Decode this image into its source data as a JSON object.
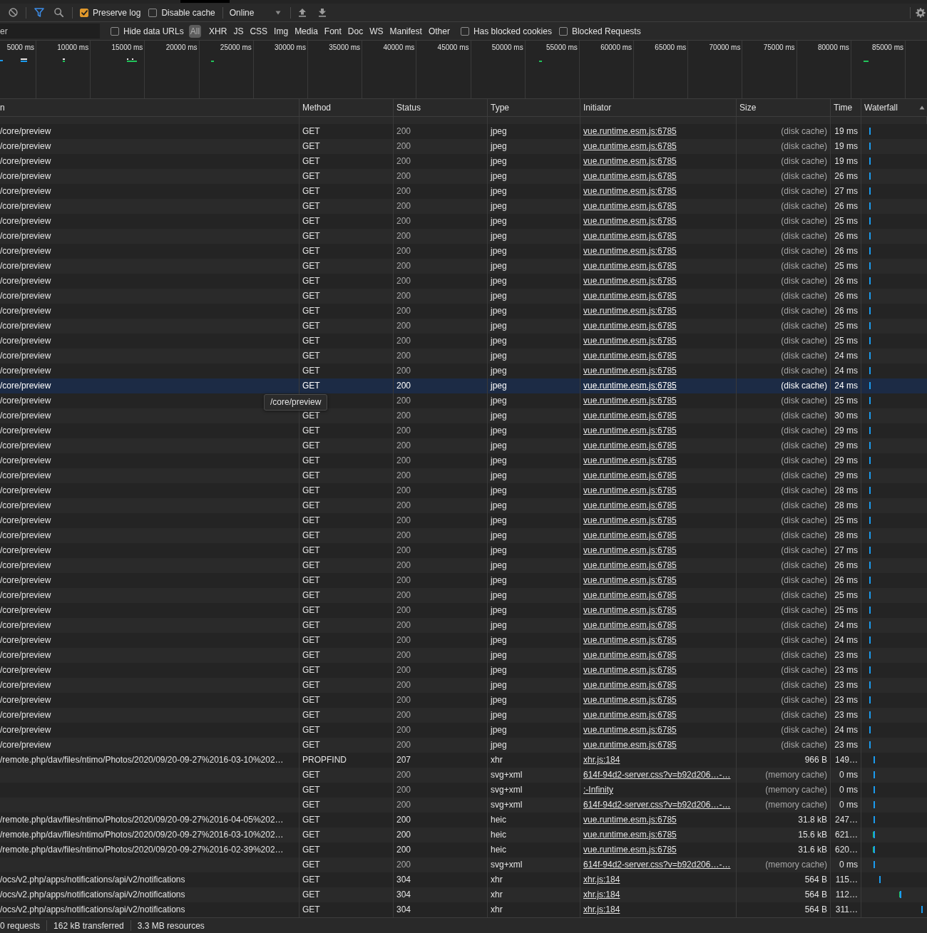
{
  "toolbar": {
    "filter_toggle": {
      "on": true
    },
    "options": [
      {
        "label": "Preserve log",
        "checked": true
      },
      {
        "label": "Disable cache",
        "checked": false
      }
    ],
    "throttling": {
      "value": "Online"
    }
  },
  "filter_bar": {
    "filter_field": {
      "placeholder": "er"
    },
    "hide_data_urls": {
      "label": "Hide data URLs",
      "checked": false
    },
    "types": [
      {
        "label": "All",
        "selected": true
      },
      {
        "label": "XHR",
        "selected": false
      },
      {
        "label": "JS",
        "selected": false
      },
      {
        "label": "CSS",
        "selected": false
      },
      {
        "label": "Img",
        "selected": false
      },
      {
        "label": "Media",
        "selected": false
      },
      {
        "label": "Font",
        "selected": false
      },
      {
        "label": "Doc",
        "selected": false
      },
      {
        "label": "WS",
        "selected": false
      },
      {
        "label": "Manifest",
        "selected": false
      },
      {
        "label": "Other",
        "selected": false
      }
    ],
    "options": [
      {
        "label": "Has blocked cookies",
        "checked": false
      },
      {
        "label": "Blocked Requests",
        "checked": false
      }
    ]
  },
  "overview": {
    "ticks": [
      "5000 ms",
      "10000 ms",
      "15000 ms",
      "20000 ms",
      "25000 ms",
      "30000 ms",
      "35000 ms",
      "40000 ms",
      "45000 ms",
      "50000 ms",
      "55000 ms",
      "60000 ms",
      "65000 ms",
      "70000 ms",
      "75000 ms",
      "80000 ms",
      "85000 ms"
    ]
  },
  "table": {
    "columns": [
      {
        "label": "n",
        "sorted": false
      },
      {
        "label": "Method",
        "sorted": false
      },
      {
        "label": "Status",
        "sorted": false
      },
      {
        "label": "Type",
        "sorted": false
      },
      {
        "label": "Initiator",
        "sorted": false
      },
      {
        "label": "Size",
        "sorted": false
      },
      {
        "label": "Time",
        "sorted": false
      },
      {
        "label": "Waterfall",
        "sorted": true
      }
    ],
    "rows": [
      {
        "name": "/core/preview",
        "method": "GET",
        "status": "200",
        "type": "jpeg",
        "initiator": "vue.runtime.esm.js:6785",
        "size": "(disk cache)",
        "time": "19 ms",
        "cached": true,
        "selected": false
      },
      {
        "name": "/core/preview",
        "method": "GET",
        "status": "200",
        "type": "jpeg",
        "initiator": "vue.runtime.esm.js:6785",
        "size": "(disk cache)",
        "time": "19 ms",
        "cached": true,
        "selected": false
      },
      {
        "name": "/core/preview",
        "method": "GET",
        "status": "200",
        "type": "jpeg",
        "initiator": "vue.runtime.esm.js:6785",
        "size": "(disk cache)",
        "time": "19 ms",
        "cached": true,
        "selected": false
      },
      {
        "name": "/core/preview",
        "method": "GET",
        "status": "200",
        "type": "jpeg",
        "initiator": "vue.runtime.esm.js:6785",
        "size": "(disk cache)",
        "time": "26 ms",
        "cached": true,
        "selected": false
      },
      {
        "name": "/core/preview",
        "method": "GET",
        "status": "200",
        "type": "jpeg",
        "initiator": "vue.runtime.esm.js:6785",
        "size": "(disk cache)",
        "time": "27 ms",
        "cached": true,
        "selected": false
      },
      {
        "name": "/core/preview",
        "method": "GET",
        "status": "200",
        "type": "jpeg",
        "initiator": "vue.runtime.esm.js:6785",
        "size": "(disk cache)",
        "time": "26 ms",
        "cached": true,
        "selected": false
      },
      {
        "name": "/core/preview",
        "method": "GET",
        "status": "200",
        "type": "jpeg",
        "initiator": "vue.runtime.esm.js:6785",
        "size": "(disk cache)",
        "time": "25 ms",
        "cached": true,
        "selected": false
      },
      {
        "name": "/core/preview",
        "method": "GET",
        "status": "200",
        "type": "jpeg",
        "initiator": "vue.runtime.esm.js:6785",
        "size": "(disk cache)",
        "time": "26 ms",
        "cached": true,
        "selected": false
      },
      {
        "name": "/core/preview",
        "method": "GET",
        "status": "200",
        "type": "jpeg",
        "initiator": "vue.runtime.esm.js:6785",
        "size": "(disk cache)",
        "time": "26 ms",
        "cached": true,
        "selected": false
      },
      {
        "name": "/core/preview",
        "method": "GET",
        "status": "200",
        "type": "jpeg",
        "initiator": "vue.runtime.esm.js:6785",
        "size": "(disk cache)",
        "time": "25 ms",
        "cached": true,
        "selected": false
      },
      {
        "name": "/core/preview",
        "method": "GET",
        "status": "200",
        "type": "jpeg",
        "initiator": "vue.runtime.esm.js:6785",
        "size": "(disk cache)",
        "time": "26 ms",
        "cached": true,
        "selected": false
      },
      {
        "name": "/core/preview",
        "method": "GET",
        "status": "200",
        "type": "jpeg",
        "initiator": "vue.runtime.esm.js:6785",
        "size": "(disk cache)",
        "time": "26 ms",
        "cached": true,
        "selected": false
      },
      {
        "name": "/core/preview",
        "method": "GET",
        "status": "200",
        "type": "jpeg",
        "initiator": "vue.runtime.esm.js:6785",
        "size": "(disk cache)",
        "time": "26 ms",
        "cached": true,
        "selected": false
      },
      {
        "name": "/core/preview",
        "method": "GET",
        "status": "200",
        "type": "jpeg",
        "initiator": "vue.runtime.esm.js:6785",
        "size": "(disk cache)",
        "time": "25 ms",
        "cached": true,
        "selected": false
      },
      {
        "name": "/core/preview",
        "method": "GET",
        "status": "200",
        "type": "jpeg",
        "initiator": "vue.runtime.esm.js:6785",
        "size": "(disk cache)",
        "time": "25 ms",
        "cached": true,
        "selected": false
      },
      {
        "name": "/core/preview",
        "method": "GET",
        "status": "200",
        "type": "jpeg",
        "initiator": "vue.runtime.esm.js:6785",
        "size": "(disk cache)",
        "time": "24 ms",
        "cached": true,
        "selected": false
      },
      {
        "name": "/core/preview",
        "method": "GET",
        "status": "200",
        "type": "jpeg",
        "initiator": "vue.runtime.esm.js:6785",
        "size": "(disk cache)",
        "time": "24 ms",
        "cached": true,
        "selected": false
      },
      {
        "name": "/core/preview",
        "method": "GET",
        "status": "200",
        "type": "jpeg",
        "initiator": "vue.runtime.esm.js:6785",
        "size": "(disk cache)",
        "time": "24 ms",
        "cached": true,
        "selected": true
      },
      {
        "name": "/core/preview",
        "status": "200",
        "type": "jpeg",
        "initiator": "vue.runtime.esm.js:6785",
        "size": "(disk cache)",
        "time": "25 ms",
        "cached": true,
        "selected": false
      },
      {
        "name": "/core/preview",
        "method": "GET",
        "status": "200",
        "type": "jpeg",
        "initiator": "vue.runtime.esm.js:6785",
        "size": "(disk cache)",
        "time": "30 ms",
        "cached": true,
        "selected": false
      },
      {
        "name": "/core/preview",
        "method": "GET",
        "status": "200",
        "type": "jpeg",
        "initiator": "vue.runtime.esm.js:6785",
        "size": "(disk cache)",
        "time": "29 ms",
        "cached": true,
        "selected": false
      },
      {
        "name": "/core/preview",
        "method": "GET",
        "status": "200",
        "type": "jpeg",
        "initiator": "vue.runtime.esm.js:6785",
        "size": "(disk cache)",
        "time": "29 ms",
        "cached": true,
        "selected": false
      },
      {
        "name": "/core/preview",
        "method": "GET",
        "status": "200",
        "type": "jpeg",
        "initiator": "vue.runtime.esm.js:6785",
        "size": "(disk cache)",
        "time": "29 ms",
        "cached": true,
        "selected": false
      },
      {
        "name": "/core/preview",
        "method": "GET",
        "status": "200",
        "type": "jpeg",
        "initiator": "vue.runtime.esm.js:6785",
        "size": "(disk cache)",
        "time": "29 ms",
        "cached": true,
        "selected": false
      },
      {
        "name": "/core/preview",
        "method": "GET",
        "status": "200",
        "type": "jpeg",
        "initiator": "vue.runtime.esm.js:6785",
        "size": "(disk cache)",
        "time": "28 ms",
        "cached": true,
        "selected": false
      },
      {
        "name": "/core/preview",
        "method": "GET",
        "status": "200",
        "type": "jpeg",
        "initiator": "vue.runtime.esm.js:6785",
        "size": "(disk cache)",
        "time": "28 ms",
        "cached": true,
        "selected": false
      },
      {
        "name": "/core/preview",
        "method": "GET",
        "status": "200",
        "type": "jpeg",
        "initiator": "vue.runtime.esm.js:6785",
        "size": "(disk cache)",
        "time": "25 ms",
        "cached": true,
        "selected": false
      },
      {
        "name": "/core/preview",
        "method": "GET",
        "status": "200",
        "type": "jpeg",
        "initiator": "vue.runtime.esm.js:6785",
        "size": "(disk cache)",
        "time": "28 ms",
        "cached": true,
        "selected": false
      },
      {
        "name": "/core/preview",
        "method": "GET",
        "status": "200",
        "type": "jpeg",
        "initiator": "vue.runtime.esm.js:6785",
        "size": "(disk cache)",
        "time": "27 ms",
        "cached": true,
        "selected": false
      },
      {
        "name": "/core/preview",
        "method": "GET",
        "status": "200",
        "type": "jpeg",
        "initiator": "vue.runtime.esm.js:6785",
        "size": "(disk cache)",
        "time": "26 ms",
        "cached": true,
        "selected": false
      },
      {
        "name": "/core/preview",
        "method": "GET",
        "status": "200",
        "type": "jpeg",
        "initiator": "vue.runtime.esm.js:6785",
        "size": "(disk cache)",
        "time": "26 ms",
        "cached": true,
        "selected": false
      },
      {
        "name": "/core/preview",
        "method": "GET",
        "status": "200",
        "type": "jpeg",
        "initiator": "vue.runtime.esm.js:6785",
        "size": "(disk cache)",
        "time": "25 ms",
        "cached": true,
        "selected": false
      },
      {
        "name": "/core/preview",
        "method": "GET",
        "status": "200",
        "type": "jpeg",
        "initiator": "vue.runtime.esm.js:6785",
        "size": "(disk cache)",
        "time": "25 ms",
        "cached": true,
        "selected": false
      },
      {
        "name": "/core/preview",
        "method": "GET",
        "status": "200",
        "type": "jpeg",
        "initiator": "vue.runtime.esm.js:6785",
        "size": "(disk cache)",
        "time": "24 ms",
        "cached": true,
        "selected": false
      },
      {
        "name": "/core/preview",
        "method": "GET",
        "status": "200",
        "type": "jpeg",
        "initiator": "vue.runtime.esm.js:6785",
        "size": "(disk cache)",
        "time": "24 ms",
        "cached": true,
        "selected": false
      },
      {
        "name": "/core/preview",
        "method": "GET",
        "status": "200",
        "type": "jpeg",
        "initiator": "vue.runtime.esm.js:6785",
        "size": "(disk cache)",
        "time": "23 ms",
        "cached": true,
        "selected": false
      },
      {
        "name": "/core/preview",
        "method": "GET",
        "status": "200",
        "type": "jpeg",
        "initiator": "vue.runtime.esm.js:6785",
        "size": "(disk cache)",
        "time": "23 ms",
        "cached": true,
        "selected": false
      },
      {
        "name": "/core/preview",
        "method": "GET",
        "status": "200",
        "type": "jpeg",
        "initiator": "vue.runtime.esm.js:6785",
        "size": "(disk cache)",
        "time": "23 ms",
        "cached": true,
        "selected": false
      },
      {
        "name": "/core/preview",
        "method": "GET",
        "status": "200",
        "type": "jpeg",
        "initiator": "vue.runtime.esm.js:6785",
        "size": "(disk cache)",
        "time": "23 ms",
        "cached": true,
        "selected": false
      },
      {
        "name": "/core/preview",
        "method": "GET",
        "status": "200",
        "type": "jpeg",
        "initiator": "vue.runtime.esm.js:6785",
        "size": "(disk cache)",
        "time": "23 ms",
        "cached": true,
        "selected": false
      },
      {
        "name": "/core/preview",
        "method": "GET",
        "status": "200",
        "type": "jpeg",
        "initiator": "vue.runtime.esm.js:6785",
        "size": "(disk cache)",
        "time": "24 ms",
        "cached": true,
        "selected": false
      },
      {
        "name": "/core/preview",
        "method": "GET",
        "status": "200",
        "type": "jpeg",
        "initiator": "vue.runtime.esm.js:6785",
        "size": "(disk cache)",
        "time": "23 ms",
        "cached": true,
        "selected": false
      },
      {
        "name": "/remote.php/dav/files/ntimo/Photos/2020/09/20-09-27%2016-03-10%202…",
        "method": "PROPFIND",
        "status": "207",
        "type": "xhr",
        "initiator": "xhr.js:184",
        "size": "966 B",
        "time": "149…",
        "cached": false,
        "selected": false
      },
      {
        "method": "GET",
        "status": "200",
        "type": "svg+xml",
        "initiator": "614f-94d2-server.css?v=b92d206…-…",
        "size": "(memory cache)",
        "time": "0 ms",
        "cached": true,
        "selected": false
      },
      {
        "method": "GET",
        "status": "200",
        "type": "svg+xml",
        "initiator": ":-Infinity",
        "size": "(memory cache)",
        "time": "0 ms",
        "cached": true,
        "selected": false
      },
      {
        "method": "GET",
        "status": "200",
        "type": "svg+xml",
        "initiator": "614f-94d2-server.css?v=b92d206…-…",
        "size": "(memory cache)",
        "time": "0 ms",
        "cached": true,
        "selected": false
      },
      {
        "name": "/remote.php/dav/files/ntimo/Photos/2020/09/20-09-27%2016-04-05%202…",
        "method": "GET",
        "status": "200",
        "type": "heic",
        "initiator": "vue.runtime.esm.js:6785",
        "size": "31.8 kB",
        "time": "247…",
        "cached": false,
        "selected": false
      },
      {
        "name": "/remote.php/dav/files/ntimo/Photos/2020/09/20-09-27%2016-03-10%202…",
        "method": "GET",
        "status": "200",
        "type": "heic",
        "initiator": "vue.runtime.esm.js:6785",
        "size": "15.6 kB",
        "time": "621…",
        "cached": false,
        "selected": false
      },
      {
        "name": "/remote.php/dav/files/ntimo/Photos/2020/09/20-09-27%2016-02-39%202…",
        "method": "GET",
        "status": "200",
        "type": "heic",
        "initiator": "vue.runtime.esm.js:6785",
        "size": "31.6 kB",
        "time": "620…",
        "cached": false,
        "selected": false
      },
      {
        "method": "GET",
        "status": "200",
        "type": "svg+xml",
        "initiator": "614f-94d2-server.css?v=b92d206…-…",
        "size": "(memory cache)",
        "time": "0 ms",
        "cached": true,
        "selected": false
      },
      {
        "name": "/ocs/v2.php/apps/notifications/api/v2/notifications",
        "method": "GET",
        "status": "304",
        "type": "xhr",
        "initiator": "xhr.js:184",
        "size": "564 B",
        "time": "115…",
        "cached": false,
        "selected": false
      },
      {
        "name": "/ocs/v2.php/apps/notifications/api/v2/notifications",
        "method": "GET",
        "status": "304",
        "type": "xhr",
        "initiator": "xhr.js:184",
        "size": "564 B",
        "time": "112…",
        "cached": false,
        "selected": false
      },
      {
        "name": "/ocs/v2.php/apps/notifications/api/v2/notifications",
        "method": "GET",
        "status": "304",
        "type": "xhr",
        "initiator": "xhr.js:184",
        "size": "564 B",
        "time": "311…",
        "cached": false,
        "selected": false
      }
    ],
    "tooltip": "/core/preview"
  },
  "status_bar": [
    "0 requests",
    "162 kB transferred",
    "3.3 MB resources"
  ]
}
